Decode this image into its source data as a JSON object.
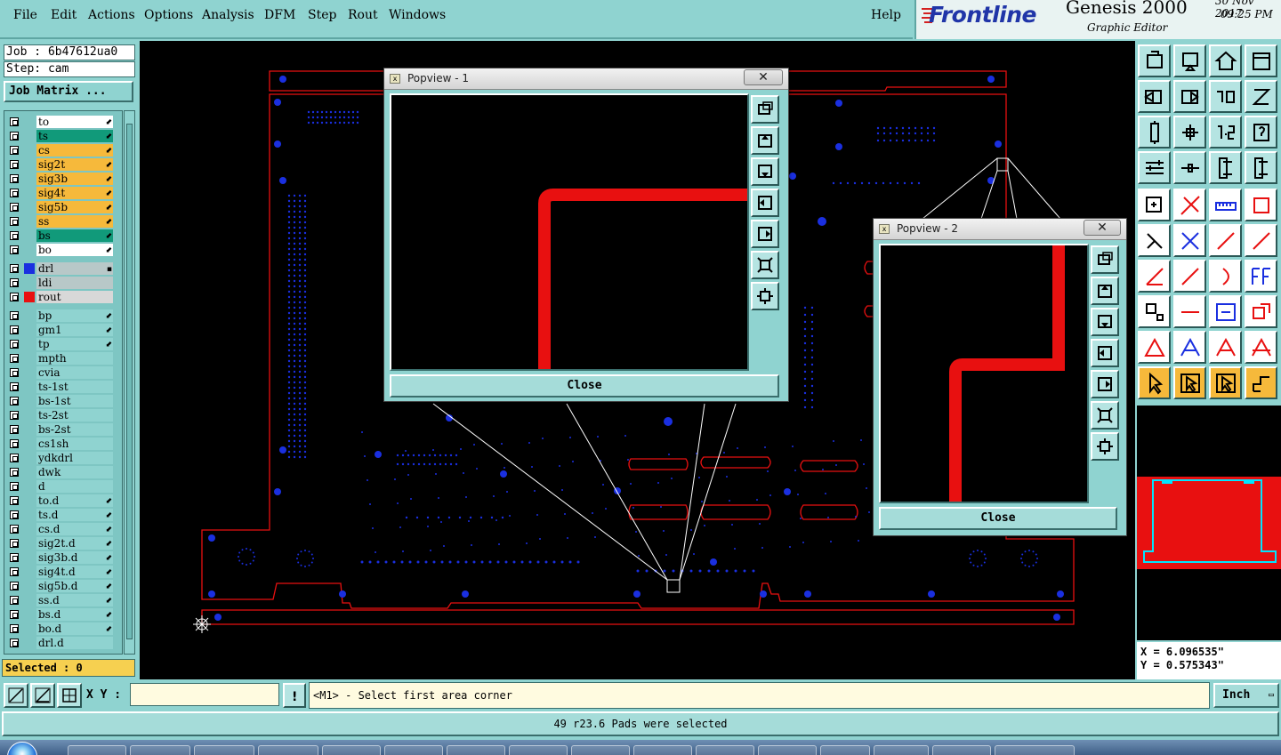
{
  "menubar": {
    "items": [
      "File",
      "Edit",
      "Actions",
      "Options",
      "Analysis",
      "DFM",
      "Step",
      "Rout",
      "Windows"
    ],
    "help": "Help"
  },
  "brand": {
    "logo": "Frontline",
    "product": "Genesis 2000",
    "subtitle": "Graphic Editor",
    "date": "30 Nov 2017",
    "time": "09:25 PM"
  },
  "left": {
    "job": "Job : 6b47612ua0",
    "step": "Step: cam",
    "job_matrix": "Job Matrix ...",
    "selected": "Selected : 0",
    "layers": [
      {
        "name": "to",
        "color": "#ffffff",
        "swatch": "",
        "mark": "⬋"
      },
      {
        "name": "ts",
        "color": "#119a7a",
        "swatch": "",
        "mark": "⬋"
      },
      {
        "name": "cs",
        "color": "#f6b93b",
        "swatch": "",
        "mark": "⬋"
      },
      {
        "name": "sig2t",
        "color": "#f6b93b",
        "swatch": "",
        "mark": "⬋"
      },
      {
        "name": "sig3b",
        "color": "#f6b93b",
        "swatch": "",
        "mark": "⬋"
      },
      {
        "name": "sig4t",
        "color": "#f6b93b",
        "swatch": "",
        "mark": "⬋"
      },
      {
        "name": "sig5b",
        "color": "#f6b93b",
        "swatch": "",
        "mark": "⬋"
      },
      {
        "name": "ss",
        "color": "#f6b93b",
        "swatch": "",
        "mark": "⬋"
      },
      {
        "name": "bs",
        "color": "#119a7a",
        "swatch": "",
        "mark": "⬋"
      },
      {
        "name": "bo",
        "color": "#ffffff",
        "swatch": "",
        "mark": "⬋"
      },
      {
        "name": "drl",
        "color": "#b8c8c8",
        "swatch": "#1a2fe0",
        "mark": "▪"
      },
      {
        "name": "ldi",
        "color": "#b8c8c8",
        "swatch": "",
        "mark": ""
      },
      {
        "name": "rout",
        "color": "#d8d8d8",
        "swatch": "#e81010",
        "mark": ""
      },
      {
        "name": "bp",
        "color": "#8fd3d0",
        "swatch": "",
        "mark": "⬋"
      },
      {
        "name": "gm1",
        "color": "#8fd3d0",
        "swatch": "",
        "mark": "⬋"
      },
      {
        "name": "tp",
        "color": "#8fd3d0",
        "swatch": "",
        "mark": "⬋"
      },
      {
        "name": "mpth",
        "color": "#8fd3d0",
        "swatch": "",
        "mark": ""
      },
      {
        "name": "cvia",
        "color": "#8fd3d0",
        "swatch": "",
        "mark": ""
      },
      {
        "name": "ts-1st",
        "color": "#8fd3d0",
        "swatch": "",
        "mark": ""
      },
      {
        "name": "bs-1st",
        "color": "#8fd3d0",
        "swatch": "",
        "mark": ""
      },
      {
        "name": "ts-2st",
        "color": "#8fd3d0",
        "swatch": "",
        "mark": ""
      },
      {
        "name": "bs-2st",
        "color": "#8fd3d0",
        "swatch": "",
        "mark": ""
      },
      {
        "name": "cs1sh",
        "color": "#8fd3d0",
        "swatch": "",
        "mark": ""
      },
      {
        "name": "ydkdrl",
        "color": "#8fd3d0",
        "swatch": "",
        "mark": ""
      },
      {
        "name": "dwk",
        "color": "#8fd3d0",
        "swatch": "",
        "mark": ""
      },
      {
        "name": "d",
        "color": "#8fd3d0",
        "swatch": "",
        "mark": ""
      },
      {
        "name": "to.d",
        "color": "#8fd3d0",
        "swatch": "",
        "mark": "⬋"
      },
      {
        "name": "ts.d",
        "color": "#8fd3d0",
        "swatch": "",
        "mark": "⬋"
      },
      {
        "name": "cs.d",
        "color": "#8fd3d0",
        "swatch": "",
        "mark": "⬋"
      },
      {
        "name": "sig2t.d",
        "color": "#8fd3d0",
        "swatch": "",
        "mark": "⬋"
      },
      {
        "name": "sig3b.d",
        "color": "#8fd3d0",
        "swatch": "",
        "mark": "⬋"
      },
      {
        "name": "sig4t.d",
        "color": "#8fd3d0",
        "swatch": "",
        "mark": "⬋"
      },
      {
        "name": "sig5b.d",
        "color": "#8fd3d0",
        "swatch": "",
        "mark": "⬋"
      },
      {
        "name": "ss.d",
        "color": "#8fd3d0",
        "swatch": "",
        "mark": "⬋"
      },
      {
        "name": "bs.d",
        "color": "#8fd3d0",
        "swatch": "",
        "mark": "⬋"
      },
      {
        "name": "bo.d",
        "color": "#8fd3d0",
        "swatch": "",
        "mark": "⬋"
      },
      {
        "name": "drl.d",
        "color": "#8fd3d0",
        "swatch": "",
        "mark": ""
      }
    ]
  },
  "popview1": {
    "title": "Popview - 1",
    "close_x": "✕",
    "close": "Close"
  },
  "popview2": {
    "title": "Popview - 2",
    "close_x": "✕",
    "close": "Close"
  },
  "right": {
    "coord_x": "X  =  6.096535\"",
    "coord_y": "Y  =  0.575343\"",
    "buttons": [
      "job-home-icon",
      "open-step-icon",
      "home-icon",
      "window-icon",
      "pan-left-icon",
      "pan-right-icon",
      "zoom-10-icon",
      "snap-icon",
      "fit-icon",
      "center-icon",
      "ratio-12-icon",
      "help-icon",
      "measure-icon",
      "probe-icon",
      "net-icon",
      "net-alt-icon",
      "pad-icon",
      "line-icon",
      "ruler-icon",
      "round-pad-icon",
      "add-node-icon",
      "delete-icon",
      "connect-icon",
      "move-node-icon",
      "angle-icon",
      "slope-icon",
      "arc-icon",
      "ff-icon",
      "shape-icon",
      "cut-icon",
      "stretch-icon",
      "group-icon",
      "triangle-icon",
      "triangle-a-icon",
      "triangle-b-icon",
      "triangle-c-icon",
      "select-icon",
      "select-box-icon",
      "select-alt-icon",
      "route-icon"
    ]
  },
  "cmd": {
    "xy_label": "X Y :",
    "xy_value": "",
    "warn": "!",
    "prompt": "<M1> - Select first area corner",
    "unit": "Inch"
  },
  "status": {
    "message": "49 r23.6 Pads were selected"
  }
}
